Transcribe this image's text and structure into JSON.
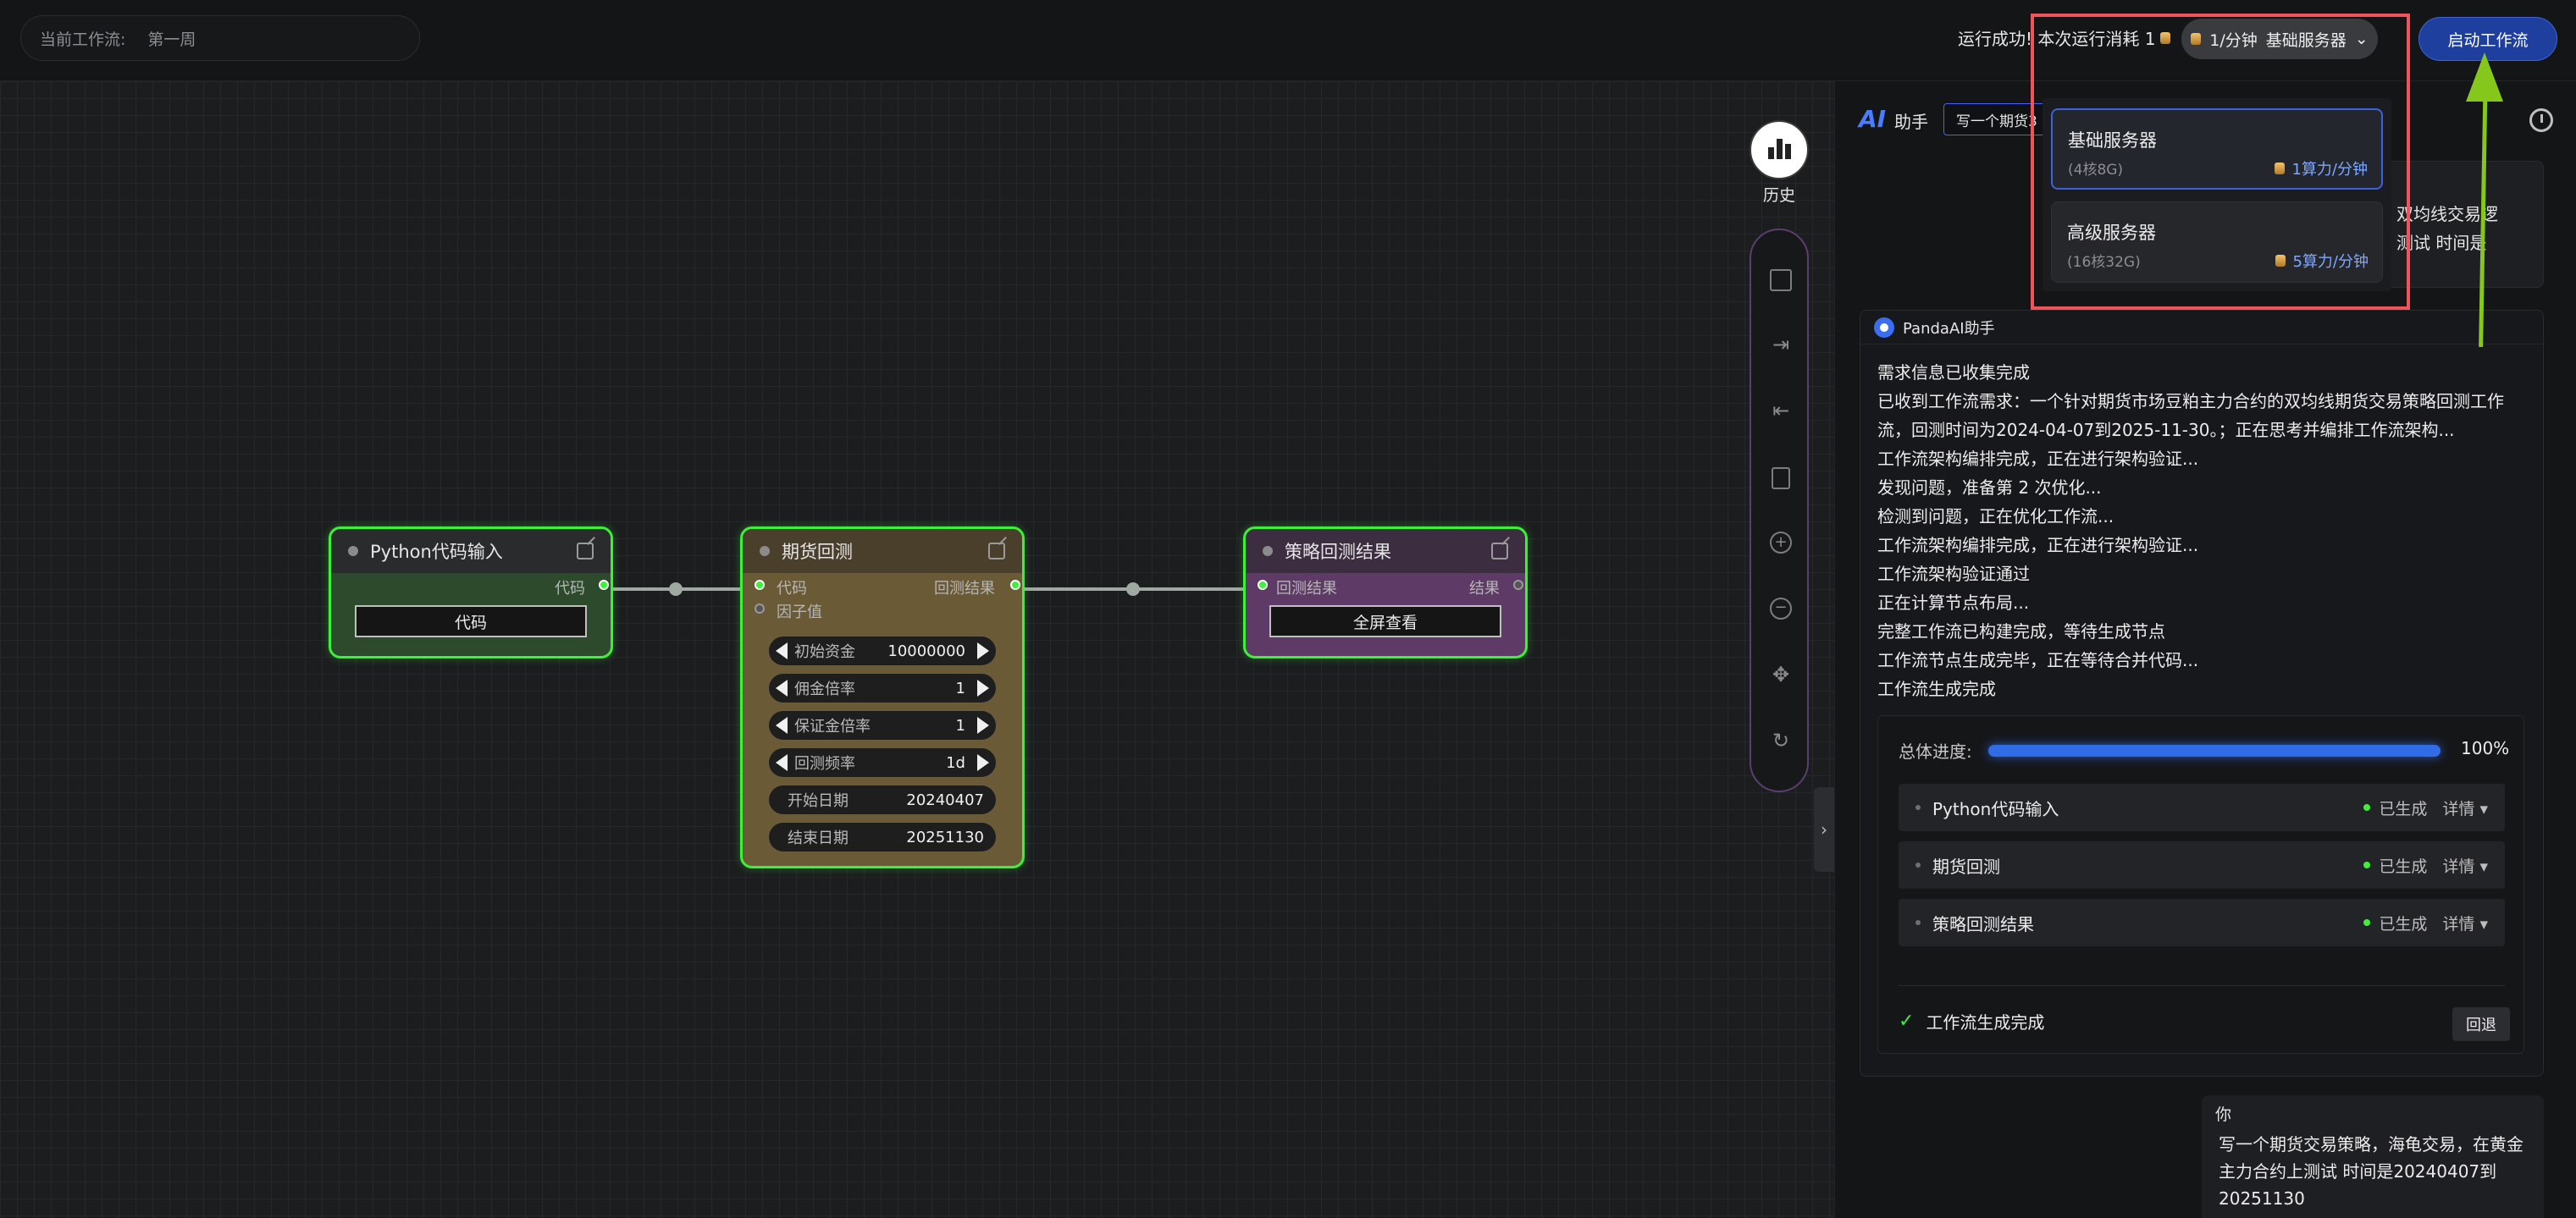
{
  "topbar": {
    "workflow_label": "当前工作流:",
    "workflow_name": "第一周",
    "run_status": "运行成功! 本次运行消耗 1",
    "server_rate": "1/分钟",
    "server_name": "基础服务器",
    "start_label": "启动工作流"
  },
  "canvas": {
    "nodes": {
      "python": {
        "title": "Python代码输入",
        "port_out": "代码",
        "button": "代码"
      },
      "futures": {
        "title": "期货回测",
        "port_in_1": "代码",
        "port_in_2": "因子值",
        "port_out": "回测结果",
        "params": [
          {
            "label": "初始资金",
            "value": "10000000"
          },
          {
            "label": "佣金倍率",
            "value": "1"
          },
          {
            "label": "保证金倍率",
            "value": "1"
          },
          {
            "label": "回测频率",
            "value": "1d"
          },
          {
            "label": "开始日期",
            "value": "20240407"
          },
          {
            "label": "结束日期",
            "value": "20251130"
          }
        ]
      },
      "result": {
        "title": "策略回测结果",
        "port_in": "回测结果",
        "port_out": "结果",
        "button": "全屏查看"
      }
    }
  },
  "toolbar": {
    "history_label": "历史",
    "tools": [
      "save-icon",
      "export-icon",
      "import-icon",
      "delete-icon",
      "zoom-in-icon",
      "zoom-out-icon",
      "move-icon",
      "refresh-icon"
    ]
  },
  "panel": {
    "ai_logo": "AI",
    "ai_title": "助手",
    "ai_query": "写一个期货3",
    "user_top_text": "双均线交易逻\n测试 时间是",
    "bot": {
      "name": "PandaAI助手",
      "lines": [
        "需求信息已收集完成",
        "已收到工作流需求：一个针对期货市场豆粕主力合约的双均线期货交易策略回测工作流，回测时间为2024-04-07到2025-11-30。；正在思考并编排工作流架构...",
        "工作流架构编排完成，正在进行架构验证...",
        "发现问题，准备第 2 次优化...",
        "检测到问题，正在优化工作流...",
        "工作流架构编排完成，正在进行架构验证...",
        "工作流架构验证通过",
        "正在计算节点布局...",
        "完整工作流已构建完成，等待生成节点",
        "工作流节点生成完毕，正在等待合并代码...",
        "工作流生成完成"
      ],
      "progress_label": "总体进度:",
      "progress_value": 1.0,
      "progress_pct": "100%",
      "steps": [
        {
          "name": "Python代码输入",
          "status": "已生成",
          "detail": "详情 ▾"
        },
        {
          "name": "期货回测",
          "status": "已生成",
          "detail": "详情 ▾"
        },
        {
          "name": "策略回测结果",
          "status": "已生成",
          "detail": "详情 ▾"
        }
      ],
      "done_label": "工作流生成完成",
      "rollback_label": "回退"
    },
    "you": {
      "label": "你",
      "text": "写一个期货交易策略，海龟交易，在黄金主力合约上测试 时间是20240407到20251130"
    }
  },
  "dropdown": {
    "options": [
      {
        "name": "基础服务器",
        "spec": "(4核8G)",
        "cost": "1算力/分钟",
        "selected": true
      },
      {
        "name": "高级服务器",
        "spec": "(16核32G)",
        "cost": "5算力/分钟",
        "selected": false
      }
    ]
  },
  "colors": {
    "accent": "#3b62d8",
    "node_border": "#3df03a",
    "highlight": "#f0545a",
    "arrow": "#86c71c"
  }
}
